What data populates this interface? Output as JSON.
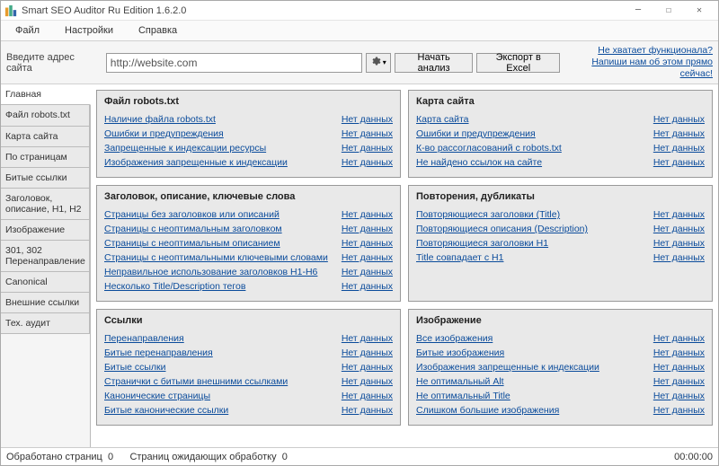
{
  "window": {
    "title": "Smart SEO Auditor Ru Edition 1.6.2.0"
  },
  "menu": {
    "file": "Файл",
    "settings": "Настройки",
    "help": "Справка"
  },
  "toolbar": {
    "address_label": "Введите адрес сайта",
    "url_value": "http://website.com",
    "start": "Начать анализ",
    "export": "Экспорт в Excel",
    "link1": "Не хватает функционала?",
    "link2": "Напиши нам об этом прямо сейчас!"
  },
  "tabs": [
    "Главная",
    "Файл robots.txt",
    "Карта сайта",
    "По страницам",
    "Битые ссылки",
    "Заголовок, описание, H1, H2",
    "Изображение",
    "301, 302 Перенаправление",
    "Canonical",
    "Внешние ссылки",
    "Тех. аудит"
  ],
  "no_data": "Нет данных",
  "panels": [
    {
      "title": "Файл robots.txt",
      "col": 1,
      "items": [
        "Наличие файла robots.txt",
        "Ошибки и предупреждения",
        "Запрещенные к индексации ресурсы",
        "Изображения запрещенные к индексации"
      ]
    },
    {
      "title": "Карта сайта",
      "col": 2,
      "items": [
        "Карта сайта",
        "Ошибки и предупреждения",
        "К-во рассогласований с robots.txt",
        "Не найдено ссылок на сайте"
      ]
    },
    {
      "title": "Заголовок, описание, ключевые слова",
      "col": 1,
      "items": [
        "Страницы без заголовков или описаний",
        "Страницы с неоптимальным заголовком",
        "Страницы с неоптимальным описанием",
        "Страницы с неоптимальными ключевыми словами",
        "Неправильное использование заголовков H1-H6",
        "Несколько Title/Description тегов"
      ]
    },
    {
      "title": "Повторения, дубликаты",
      "col": 2,
      "items": [
        "Повторяющиеся заголовки (Title)",
        "Повторяющиеся описания (Description)",
        "Повторяющиеся заголовки H1",
        "Title совпадает с H1"
      ]
    },
    {
      "title": "Ссылки",
      "col": 1,
      "items": [
        "Перенаправления",
        "Битые перенаправления",
        "Битые ссылки",
        "Странички с битыми внешними ссылками",
        "Канонические страницы",
        "Битые канонические ссылки"
      ]
    },
    {
      "title": "Изображение",
      "col": 2,
      "items": [
        "Все изображения",
        "Битые изображения",
        "Изображения запрещенные к индексации",
        "Не оптимальный Alt",
        "Не оптимальный Title",
        "Слишком большие изображения"
      ]
    }
  ],
  "status": {
    "processed_label": "Обработано страниц",
    "processed_value": "0",
    "pending_label": "Страниц ожидающих обработку",
    "pending_value": "0",
    "time": "00:00:00"
  }
}
